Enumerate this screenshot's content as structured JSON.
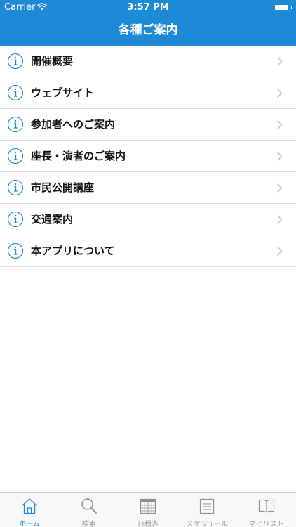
{
  "status_bar": {
    "carrier": "Carrier",
    "time": "3:57 PM"
  },
  "nav": {
    "title": "各種ご案内"
  },
  "list": {
    "items": [
      {
        "label": "開催概要",
        "icon": "info-icon"
      },
      {
        "label": "ウェブサイト",
        "icon": "info-icon"
      },
      {
        "label": "参加者へのご案内",
        "icon": "info-icon"
      },
      {
        "label": "座長・演者のご案内",
        "icon": "info-icon"
      },
      {
        "label": "市民公開講座",
        "icon": "info-icon"
      },
      {
        "label": "交通案内",
        "icon": "info-icon"
      },
      {
        "label": "本アプリについて",
        "icon": "info-icon"
      }
    ]
  },
  "tabbar": {
    "tabs": [
      {
        "label": "ホーム",
        "icon": "home-icon",
        "active": true
      },
      {
        "label": "検索",
        "icon": "search-icon",
        "active": false
      },
      {
        "label": "日程表",
        "icon": "calendar-icon",
        "active": false
      },
      {
        "label": "スケジュール",
        "icon": "schedule-icon",
        "active": false
      },
      {
        "label": "マイリスト",
        "icon": "book-icon",
        "active": false
      }
    ]
  },
  "colors": {
    "accent": "#1c8ad6",
    "tab_inactive": "#9a9a9a",
    "divider": "#dcdcdc"
  }
}
